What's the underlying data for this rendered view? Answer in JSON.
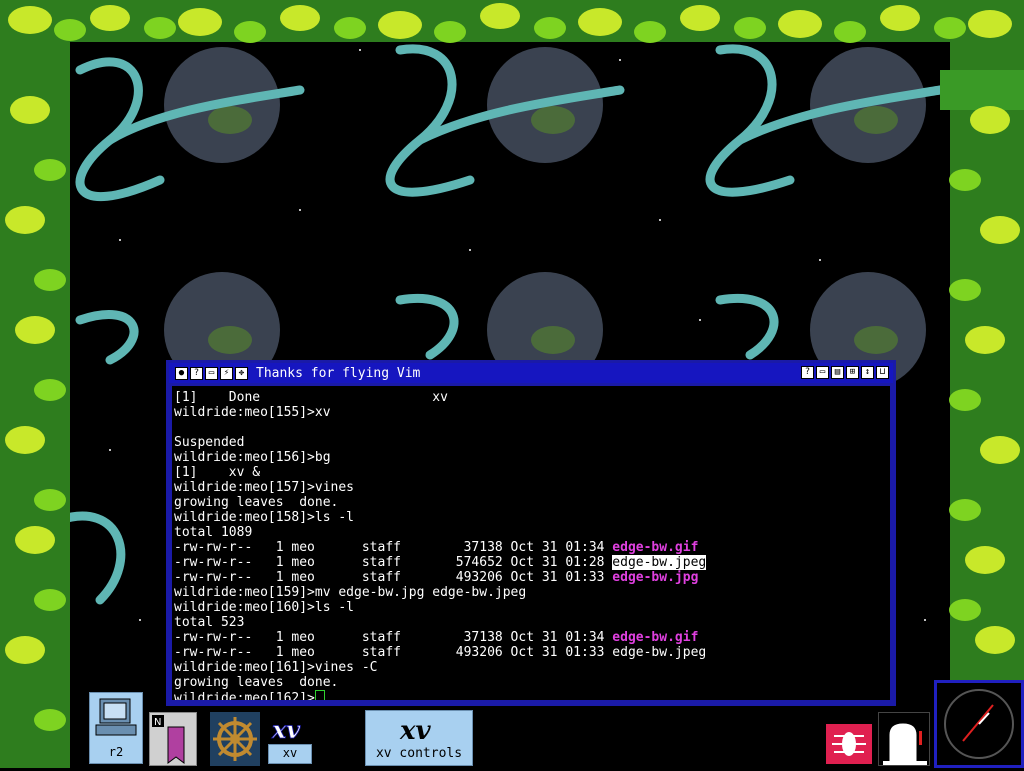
{
  "window": {
    "title": "Thanks for flying Vim",
    "left_buttons": [
      "menu",
      "help",
      "iconify",
      "zap",
      "sticky"
    ],
    "right_buttons": [
      "help",
      "iconify",
      "shade",
      "zoom",
      "raise",
      "maximize"
    ]
  },
  "terminal": {
    "lines": [
      {
        "text": "[1]    Done                      xv"
      },
      {
        "text": "wildride:meo[155]>xv"
      },
      {
        "text": ""
      },
      {
        "text": "Suspended"
      },
      {
        "text": "wildride:meo[156]>bg"
      },
      {
        "text": "[1]    xv &"
      },
      {
        "text": "wildride:meo[157]>vines"
      },
      {
        "text": "growing leaves  done."
      },
      {
        "text": "wildride:meo[158]>ls -l"
      },
      {
        "text": "total 1089"
      },
      {
        "text": "-rw-rw-r--   1 meo      staff        37138 Oct 31 01:34 ",
        "file": "edge-bw.gif",
        "style": "mag"
      },
      {
        "text": "-rw-rw-r--   1 meo      staff       574652 Oct 31 01:28 ",
        "file": "edge-bw.jpeg",
        "style": "hl"
      },
      {
        "text": "-rw-rw-r--   1 meo      staff       493206 Oct 31 01:33 ",
        "file": "edge-bw.jpg",
        "style": "mag"
      },
      {
        "text": "wildride:meo[159]>mv edge-bw.jpg edge-bw.jpeg"
      },
      {
        "text": "wildride:meo[160]>ls -l"
      },
      {
        "text": "total 523"
      },
      {
        "text": "-rw-rw-r--   1 meo      staff        37138 Oct 31 01:34 ",
        "file": "edge-bw.gif",
        "style": "mag"
      },
      {
        "text": "-rw-rw-r--   1 meo      staff       493206 Oct 31 01:33 ",
        "file": "edge-bw.jpeg",
        "style": "plain"
      },
      {
        "text": "wildride:meo[161]>vines -C"
      },
      {
        "text": "growing leaves  done."
      },
      {
        "text": "wildride:meo[162]>",
        "cursor": true
      }
    ]
  },
  "dock": {
    "r2_label": "r2",
    "xv_label": "xv",
    "xv_controls_label": "xv controls",
    "xv_logo": "xv",
    "notes_letter": "N"
  },
  "colors": {
    "window_frame": "#1a1aa8",
    "titlebar": "#1616c0",
    "file_highlight": "#e040e0",
    "cursor": "#2fd02f",
    "dock_blue": "#a8d0f0"
  }
}
